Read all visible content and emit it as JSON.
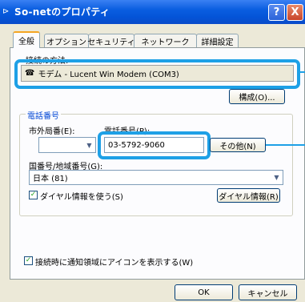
{
  "window": {
    "title": "So-netのプロパティ",
    "help_icon": "?",
    "close_icon": "X"
  },
  "tabs": [
    {
      "label": "全般"
    },
    {
      "label": "オプション"
    },
    {
      "label": "セキュリティ"
    },
    {
      "label": "ネットワーク"
    },
    {
      "label": "詳細設定"
    }
  ],
  "connection": {
    "label": "接続の方法:",
    "device": "モデム - Lucent Win Modem (COM3)",
    "configure_button": "構成(O)..."
  },
  "phone": {
    "group_label": "電話番号",
    "area_code_label": "市外局番(E):",
    "area_code_value": "",
    "phone_label": "電話番号(P):",
    "phone_value": "03-5792-9060",
    "other_button": "その他(N)",
    "country_label": "国番号/地域番号(G):",
    "country_value": "日本 (81)",
    "use_dialing_rules": "ダイヤル情報を使う(S)",
    "dialing_rules_button": "ダイヤル情報(R)"
  },
  "notify": {
    "label": "接続時に通知領域にアイコンを表示する(W)"
  },
  "footer": {
    "ok": "OK",
    "cancel": "キャンセル"
  },
  "colors": {
    "highlight": "#1ea0e6",
    "titlebar": "#0a5ee0",
    "dialog_bg": "#ece9d8"
  }
}
